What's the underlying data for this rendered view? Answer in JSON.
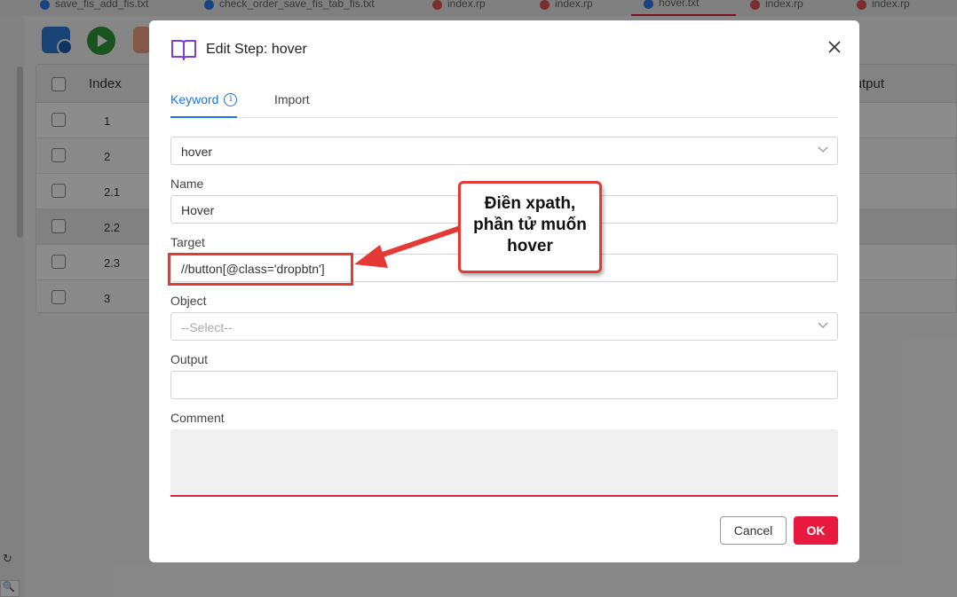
{
  "tabs": [
    {
      "label": "save_fis_add_fis.txt",
      "color": "#2b7de9"
    },
    {
      "label": "check_order_save_fis_tab_fis.txt",
      "color": "#2b7de9"
    },
    {
      "label": "index.rp",
      "color": "#e05555"
    },
    {
      "label": "index.rp",
      "color": "#e05555"
    },
    {
      "label": "hover.txt",
      "color": "#2b7de9"
    },
    {
      "label": "index.rp",
      "color": "#e05555"
    },
    {
      "label": "index.rp",
      "color": "#e05555"
    }
  ],
  "grid": {
    "header_index": "Index",
    "header_output": "Output",
    "rows": [
      "1",
      "2",
      "2.1",
      "2.2",
      "2.3",
      "3"
    ]
  },
  "modal": {
    "title": "Edit Step: hover",
    "tab_keyword": "Keyword",
    "tab_import": "Import",
    "keyword_value": "hover",
    "name_label": "Name",
    "name_value": "Hover",
    "target_label": "Target",
    "target_value": "//button[@class='dropbtn']",
    "object_label": "Object",
    "object_placeholder": "--Select--",
    "output_label": "Output",
    "output_value": "",
    "comment_label": "Comment",
    "cancel_label": "Cancel",
    "ok_label": "OK"
  },
  "annotation": {
    "callout_line1": "Điền xpath,",
    "callout_line2": "phần tử muốn",
    "callout_line3": "hover",
    "color": "#e53935"
  }
}
